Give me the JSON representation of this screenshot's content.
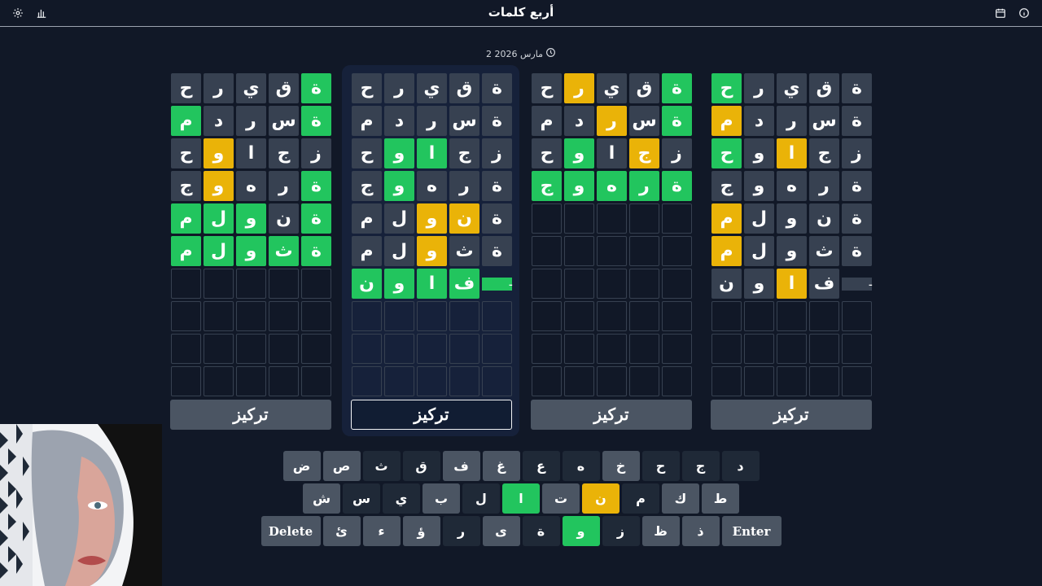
{
  "header": {
    "title": "أربع كلمات",
    "left_icons": [
      "settings-icon",
      "stats-icon"
    ],
    "right_icons": [
      "calendar-icon",
      "info-icon"
    ]
  },
  "date": {
    "text": "2 مارس 2026",
    "icon": "clock-icon"
  },
  "boards": [
    {
      "rows": [
        [
          {
            "l": "ة",
            "s": "green"
          },
          {
            "l": "ق",
            "s": "gray"
          },
          {
            "l": "ي",
            "s": "gray"
          },
          {
            "l": "ر",
            "s": "gray"
          },
          {
            "l": "ح",
            "s": "gray"
          }
        ],
        [
          {
            "l": "ة",
            "s": "green"
          },
          {
            "l": "س",
            "s": "gray"
          },
          {
            "l": "ر",
            "s": "gray"
          },
          {
            "l": "د",
            "s": "gray"
          },
          {
            "l": "م",
            "s": "green"
          }
        ],
        [
          {
            "l": "ز",
            "s": "gray"
          },
          {
            "l": "ج",
            "s": "gray"
          },
          {
            "l": "ا",
            "s": "gray"
          },
          {
            "l": "و",
            "s": "yellow"
          },
          {
            "l": "ح",
            "s": "gray"
          }
        ],
        [
          {
            "l": "ة",
            "s": "green"
          },
          {
            "l": "ر",
            "s": "gray"
          },
          {
            "l": "ه",
            "s": "gray"
          },
          {
            "l": "و",
            "s": "yellow"
          },
          {
            "l": "ج",
            "s": "gray"
          }
        ],
        [
          {
            "l": "ة",
            "s": "green"
          },
          {
            "l": "ن",
            "s": "gray"
          },
          {
            "l": "و",
            "s": "green"
          },
          {
            "l": "ل",
            "s": "green"
          },
          {
            "l": "م",
            "s": "green"
          }
        ],
        [
          {
            "l": "ة",
            "s": "green"
          },
          {
            "l": "ث",
            "s": "green"
          },
          {
            "l": "و",
            "s": "green"
          },
          {
            "l": "ل",
            "s": "green"
          },
          {
            "l": "م",
            "s": "green"
          }
        ]
      ],
      "focus_label": "تركيز",
      "active": false
    },
    {
      "rows": [
        [
          {
            "l": "ة",
            "s": "gray"
          },
          {
            "l": "ق",
            "s": "gray"
          },
          {
            "l": "ي",
            "s": "gray"
          },
          {
            "l": "ر",
            "s": "gray"
          },
          {
            "l": "ح",
            "s": "gray"
          }
        ],
        [
          {
            "l": "ة",
            "s": "gray"
          },
          {
            "l": "س",
            "s": "gray"
          },
          {
            "l": "ر",
            "s": "gray"
          },
          {
            "l": "د",
            "s": "gray"
          },
          {
            "l": "م",
            "s": "gray"
          }
        ],
        [
          {
            "l": "ز",
            "s": "gray"
          },
          {
            "l": "ج",
            "s": "gray"
          },
          {
            "l": "ا",
            "s": "green"
          },
          {
            "l": "و",
            "s": "green"
          },
          {
            "l": "ح",
            "s": "gray"
          }
        ],
        [
          {
            "l": "ة",
            "s": "gray"
          },
          {
            "l": "ر",
            "s": "gray"
          },
          {
            "l": "ه",
            "s": "gray"
          },
          {
            "l": "و",
            "s": "green"
          },
          {
            "l": "ج",
            "s": "gray"
          }
        ],
        [
          {
            "l": "ة",
            "s": "gray"
          },
          {
            "l": "ن",
            "s": "yellow"
          },
          {
            "l": "و",
            "s": "yellow"
          },
          {
            "l": "ل",
            "s": "gray"
          },
          {
            "l": "م",
            "s": "gray"
          }
        ],
        [
          {
            "l": "ة",
            "s": "gray"
          },
          {
            "l": "ث",
            "s": "gray"
          },
          {
            "l": "و",
            "s": "yellow"
          },
          {
            "l": "ل",
            "s": "gray"
          },
          {
            "l": "م",
            "s": "gray"
          }
        ],
        [
          {
            "l": "ـ",
            "s": "green-partial"
          },
          {
            "l": "ف",
            "s": "green"
          },
          {
            "l": "ا",
            "s": "green"
          },
          {
            "l": "و",
            "s": "green"
          },
          {
            "l": "ن",
            "s": "green"
          }
        ]
      ],
      "focus_label": "تركيز",
      "active": true
    },
    {
      "rows": [
        [
          {
            "l": "ة",
            "s": "green"
          },
          {
            "l": "ق",
            "s": "gray"
          },
          {
            "l": "ي",
            "s": "gray"
          },
          {
            "l": "ر",
            "s": "yellow"
          },
          {
            "l": "ح",
            "s": "gray"
          }
        ],
        [
          {
            "l": "ة",
            "s": "green"
          },
          {
            "l": "س",
            "s": "gray"
          },
          {
            "l": "ر",
            "s": "yellow"
          },
          {
            "l": "د",
            "s": "gray"
          },
          {
            "l": "م",
            "s": "gray"
          }
        ],
        [
          {
            "l": "ز",
            "s": "gray"
          },
          {
            "l": "ج",
            "s": "yellow"
          },
          {
            "l": "ا",
            "s": "gray"
          },
          {
            "l": "و",
            "s": "green"
          },
          {
            "l": "ح",
            "s": "gray"
          }
        ],
        [
          {
            "l": "ة",
            "s": "green"
          },
          {
            "l": "ر",
            "s": "green"
          },
          {
            "l": "ه",
            "s": "green"
          },
          {
            "l": "و",
            "s": "green"
          },
          {
            "l": "ج",
            "s": "green"
          }
        ]
      ],
      "focus_label": "تركيز",
      "active": false
    },
    {
      "rows": [
        [
          {
            "l": "ة",
            "s": "gray"
          },
          {
            "l": "ق",
            "s": "gray"
          },
          {
            "l": "ي",
            "s": "gray"
          },
          {
            "l": "ر",
            "s": "gray"
          },
          {
            "l": "ح",
            "s": "green"
          }
        ],
        [
          {
            "l": "ة",
            "s": "gray"
          },
          {
            "l": "س",
            "s": "gray"
          },
          {
            "l": "ر",
            "s": "gray"
          },
          {
            "l": "د",
            "s": "gray"
          },
          {
            "l": "م",
            "s": "yellow"
          }
        ],
        [
          {
            "l": "ز",
            "s": "gray"
          },
          {
            "l": "ج",
            "s": "gray"
          },
          {
            "l": "ا",
            "s": "yellow"
          },
          {
            "l": "و",
            "s": "gray"
          },
          {
            "l": "ح",
            "s": "green"
          }
        ],
        [
          {
            "l": "ة",
            "s": "gray"
          },
          {
            "l": "ر",
            "s": "gray"
          },
          {
            "l": "ه",
            "s": "gray"
          },
          {
            "l": "و",
            "s": "gray"
          },
          {
            "l": "ج",
            "s": "gray"
          }
        ],
        [
          {
            "l": "ة",
            "s": "gray"
          },
          {
            "l": "ن",
            "s": "gray"
          },
          {
            "l": "و",
            "s": "gray"
          },
          {
            "l": "ل",
            "s": "gray"
          },
          {
            "l": "م",
            "s": "yellow"
          }
        ],
        [
          {
            "l": "ة",
            "s": "gray"
          },
          {
            "l": "ث",
            "s": "gray"
          },
          {
            "l": "و",
            "s": "gray"
          },
          {
            "l": "ل",
            "s": "gray"
          },
          {
            "l": "م",
            "s": "yellow"
          }
        ],
        [
          {
            "l": "ـ",
            "s": "gray-partial"
          },
          {
            "l": "ف",
            "s": "gray"
          },
          {
            "l": "ا",
            "s": "yellow"
          },
          {
            "l": "و",
            "s": "gray"
          },
          {
            "l": "ن",
            "s": "gray"
          }
        ]
      ],
      "focus_label": "تركيز",
      "active": false
    }
  ],
  "keyboard": {
    "rows": [
      [
        {
          "k": "د",
          "s": "dark"
        },
        {
          "k": "ج",
          "s": "dark"
        },
        {
          "k": "ح",
          "s": "dark"
        },
        {
          "k": "خ",
          "s": "light"
        },
        {
          "k": "ه",
          "s": "dark"
        },
        {
          "k": "ع",
          "s": "dark"
        },
        {
          "k": "غ",
          "s": "light"
        },
        {
          "k": "ف",
          "s": "light"
        },
        {
          "k": "ق",
          "s": "dark"
        },
        {
          "k": "ث",
          "s": "dark"
        },
        {
          "k": "ص",
          "s": "light"
        },
        {
          "k": "ض",
          "s": "light"
        }
      ],
      [
        {
          "k": "ط",
          "s": "light"
        },
        {
          "k": "ك",
          "s": "light"
        },
        {
          "k": "م",
          "s": "dark"
        },
        {
          "k": "ن",
          "s": "yellow"
        },
        {
          "k": "ت",
          "s": "light"
        },
        {
          "k": "ا",
          "s": "green"
        },
        {
          "k": "ل",
          "s": "dark"
        },
        {
          "k": "ب",
          "s": "light"
        },
        {
          "k": "ي",
          "s": "dark"
        },
        {
          "k": "س",
          "s": "dark"
        },
        {
          "k": "ش",
          "s": "light"
        }
      ],
      [
        {
          "k": "Enter",
          "s": "light",
          "wide": true
        },
        {
          "k": "ذ",
          "s": "light"
        },
        {
          "k": "ظ",
          "s": "light"
        },
        {
          "k": "ز",
          "s": "dark"
        },
        {
          "k": "و",
          "s": "green"
        },
        {
          "k": "ة",
          "s": "dark"
        },
        {
          "k": "ى",
          "s": "light"
        },
        {
          "k": "ر",
          "s": "dark"
        },
        {
          "k": "ؤ",
          "s": "light"
        },
        {
          "k": "ء",
          "s": "light"
        },
        {
          "k": "ئ",
          "s": "light"
        },
        {
          "k": "Delete",
          "s": "light",
          "wide": true
        }
      ]
    ]
  },
  "colors": {
    "green": "#22c55e",
    "yellow": "#eab308",
    "gray": "#374151",
    "background": "#111827"
  }
}
